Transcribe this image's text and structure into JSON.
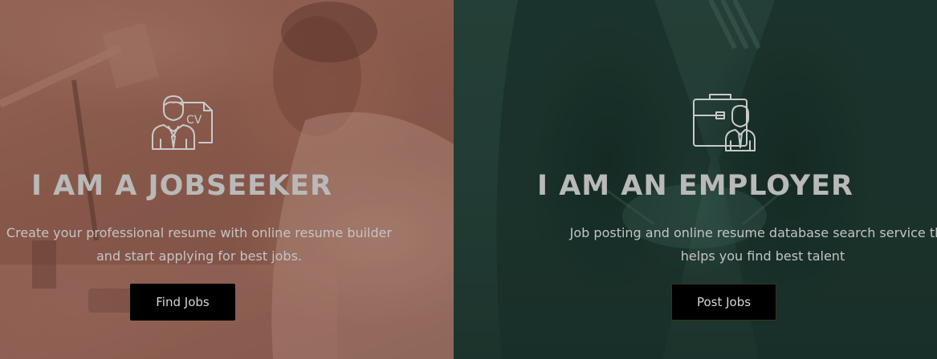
{
  "jobseeker": {
    "icon": "cv-person-icon",
    "title": "I AM A JOBSEEKER",
    "description_line1": "Create your professional resume with online resume builder",
    "description_line2": "and start applying for best jobs.",
    "button_label": "Find Jobs",
    "tint_color": "#a56c5b"
  },
  "employer": {
    "icon": "briefcase-person-icon",
    "title": "I AM AN EMPLOYER",
    "description_line1": "Job posting and online resume database search service that",
    "description_line2": "helps you find best talent",
    "button_label": "Post Jobs",
    "tint_color": "#2a4a41"
  }
}
